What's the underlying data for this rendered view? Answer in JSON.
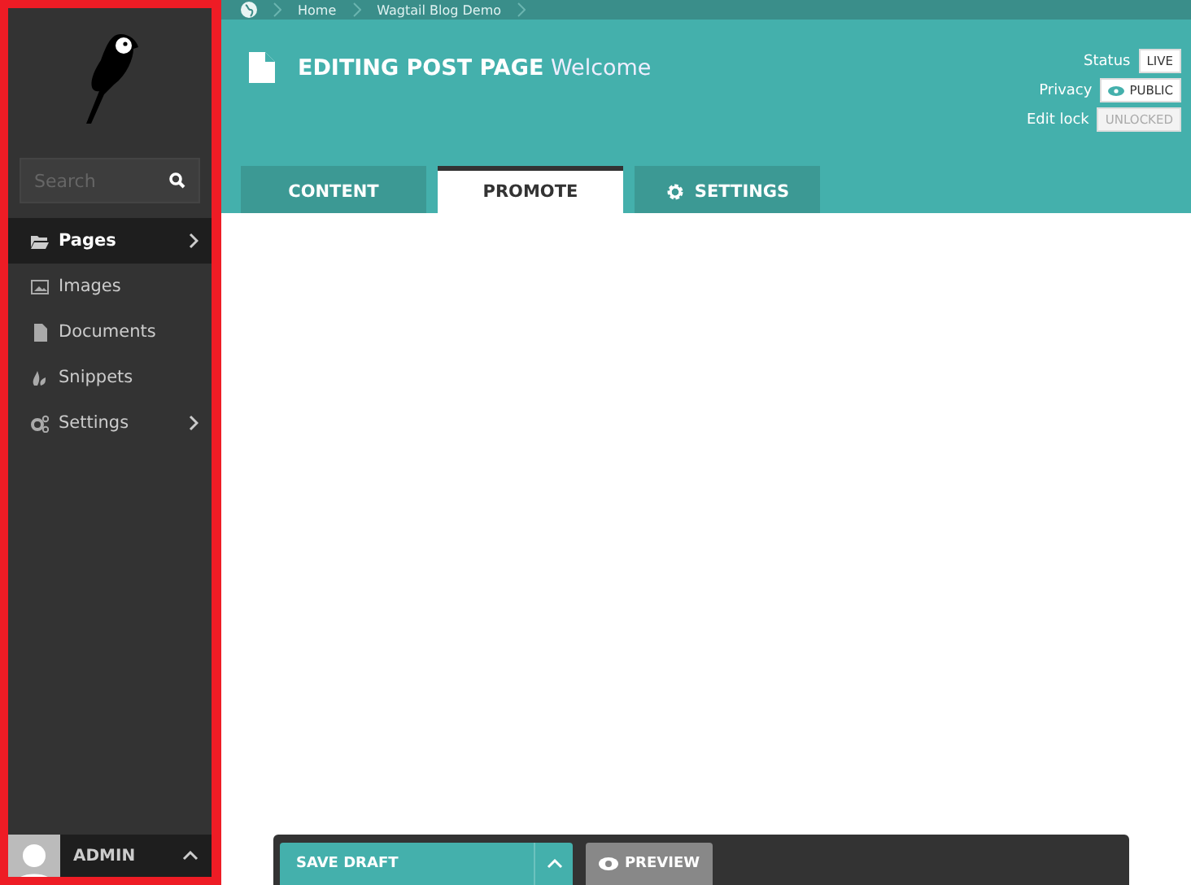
{
  "sidebar": {
    "search": {
      "placeholder": "Search"
    },
    "items": [
      {
        "label": "Pages",
        "selected": true,
        "expandable": true
      },
      {
        "label": "Images",
        "selected": false,
        "expandable": false
      },
      {
        "label": "Documents",
        "selected": false,
        "expandable": false
      },
      {
        "label": "Snippets",
        "selected": false,
        "expandable": false
      },
      {
        "label": "Settings",
        "selected": false,
        "expandable": true
      }
    ],
    "user": "ADMIN"
  },
  "breadcrumb": [
    "Home",
    "Wagtail Blog Demo"
  ],
  "header": {
    "action": "EDITING POST PAGE",
    "page": "Welcome"
  },
  "meta": [
    {
      "label": "Status",
      "value": "LIVE",
      "kind": "plain"
    },
    {
      "label": "Privacy",
      "value": "PUBLIC",
      "kind": "privacy"
    },
    {
      "label": "Edit lock",
      "value": "UNLOCKED",
      "kind": "disabled"
    }
  ],
  "tabs": [
    {
      "label": "CONTENT",
      "selected": false
    },
    {
      "label": "PROMOTE",
      "selected": true
    },
    {
      "label": "SETTINGS",
      "selected": false
    }
  ],
  "footer": {
    "save": "SAVE DRAFT",
    "preview": "PREVIEW"
  }
}
